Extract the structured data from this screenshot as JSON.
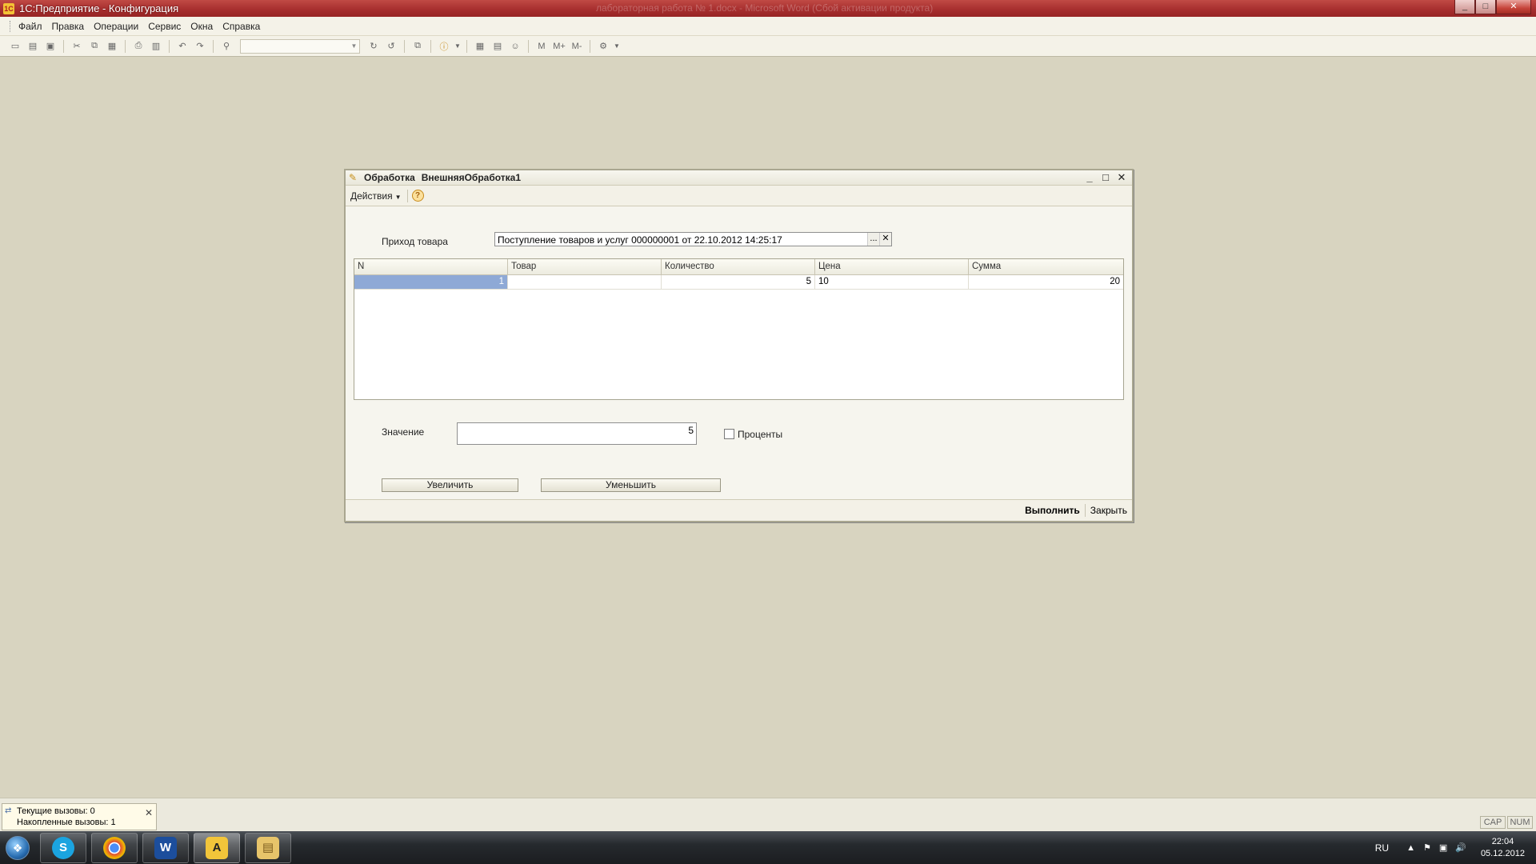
{
  "app": {
    "title": "1С:Предприятие - Конфигурация",
    "title_faded": "лабораторная работа № 1.docx - Microsoft Word (Сбой активации продукта)",
    "window_controls": {
      "minimize": "_",
      "maximize": "□",
      "close": "✕"
    }
  },
  "menubar": [
    "Файл",
    "Правка",
    "Операции",
    "Сервис",
    "Окна",
    "Справка"
  ],
  "toolbar": {
    "icons": [
      "new-icon",
      "open-icon",
      "save-icon",
      "cut-icon",
      "copy-icon",
      "paste-icon",
      "print-icon",
      "preview-icon",
      "undo-icon",
      "redo-icon",
      "search-icon"
    ],
    "search_value": "",
    "memo_buttons": [
      "M",
      "M+",
      "M-"
    ]
  },
  "form": {
    "title_prefix": "Обработка",
    "title_name": "ВнешняяОбработка1",
    "actions_label": "Действия",
    "help_label": "?",
    "goods_receipt_label": "Приход товара",
    "goods_receipt_value": "Поступление товаров и услуг 000000001 от 22.10.2012 14:25:17",
    "select_btn": "...",
    "clear_btn": "✕",
    "table": {
      "columns": [
        "N",
        "Товар",
        "Количество",
        "Цена",
        "Сумма"
      ],
      "rows": [
        {
          "n": "1",
          "product": "",
          "qty": "5",
          "price": "10",
          "sum": "20"
        }
      ]
    },
    "value_label": "Значение",
    "value": "5",
    "percent_label": "Проценты",
    "percent_checked": false,
    "increase_btn": "Увеличить",
    "decrease_btn": "Уменьшить",
    "execute_btn": "Выполнить",
    "close_btn": "Закрыть"
  },
  "status": {
    "current_calls": "Текущие вызовы: 0",
    "accumulated_calls": "Накопленные вызовы: 1",
    "cap": "CAP",
    "num": "NUM"
  },
  "taskbar": {
    "apps": [
      "skype",
      "chrome",
      "word",
      "1c-enterprise",
      "explorer"
    ],
    "lang": "RU",
    "time": "22:04",
    "date": "05.12.2012"
  }
}
